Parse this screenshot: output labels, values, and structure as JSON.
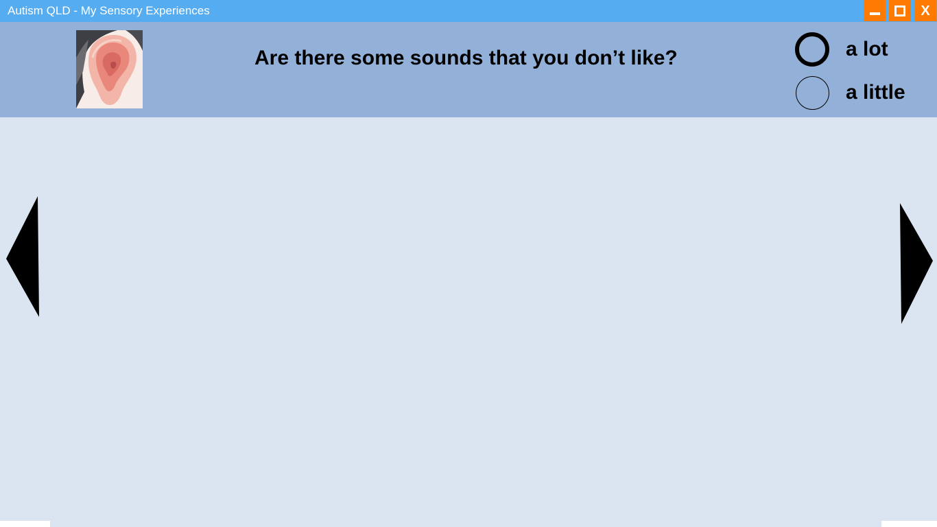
{
  "window": {
    "title": "Autism QLD - My Sensory Experiences",
    "controls": {
      "minimize": "minimize-icon",
      "maximize": "maximize-icon",
      "close_label": "X"
    }
  },
  "question": {
    "text": "Are there some sounds that you don’t like?",
    "image": "ear-image"
  },
  "answers": {
    "options": [
      {
        "label": "a lot",
        "selected": true
      },
      {
        "label": "a little",
        "selected": false
      }
    ]
  },
  "navigation": {
    "previous": "left-arrow-icon",
    "next": "right-arrow-icon"
  },
  "colors": {
    "titlebar": "#55acf0",
    "window_buttons": "#ff7a00",
    "question_bar": "#93b1d8",
    "content_bg": "#dbe5f1"
  }
}
